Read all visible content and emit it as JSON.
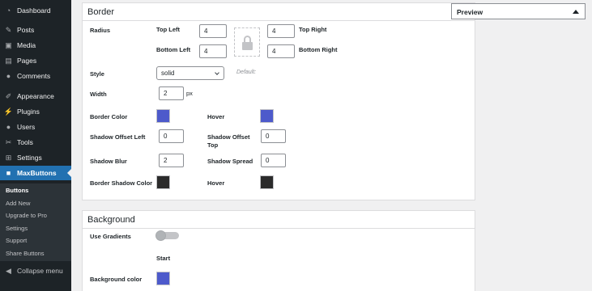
{
  "sidebar": {
    "items": [
      {
        "label": "Dashboard",
        "icon": "dashboard-icon",
        "glyph": "◔"
      },
      {
        "label": "Posts",
        "icon": "pin-icon",
        "glyph": "✎"
      },
      {
        "label": "Media",
        "icon": "media-icon",
        "glyph": "▣"
      },
      {
        "label": "Pages",
        "icon": "pages-icon",
        "glyph": "▤"
      },
      {
        "label": "Comments",
        "icon": "comments-icon",
        "glyph": "●"
      },
      {
        "label": "Appearance",
        "icon": "brush-icon",
        "glyph": "✐"
      },
      {
        "label": "Plugins",
        "icon": "plugin-icon",
        "glyph": "⚡"
      },
      {
        "label": "Users",
        "icon": "users-icon",
        "glyph": "●"
      },
      {
        "label": "Tools",
        "icon": "wrench-icon",
        "glyph": "✂"
      },
      {
        "label": "Settings",
        "icon": "settings-icon",
        "glyph": "⊞"
      },
      {
        "label": "MaxButtons",
        "icon": "maxbuttons-icon",
        "glyph": "■"
      }
    ],
    "submenu": [
      "Buttons",
      "Add New",
      "Upgrade to Pro",
      "Settings",
      "Support",
      "Share Buttons"
    ],
    "collapse_label": "Collapse menu",
    "collapse_glyph": "◀"
  },
  "border": {
    "title": "Border",
    "radius_label": "Radius",
    "top_left_label": "Top Left",
    "top_left_value": "4",
    "top_right_label": "Top Right",
    "top_right_value": "4",
    "bottom_left_label": "Bottom Left",
    "bottom_left_value": "4",
    "bottom_right_label": "Bottom Right",
    "bottom_right_value": "4",
    "style_label": "Style",
    "style_value": "solid",
    "style_default": "Default:",
    "width_label": "Width",
    "width_value": "2",
    "width_unit": "px",
    "border_color_label": "Border Color",
    "border_color": "#4d5acb",
    "hover_label": "Hover",
    "hover_color": "#4d5acb",
    "shadow_offset_left_label": "Shadow Offset Left",
    "shadow_offset_left_value": "0",
    "shadow_offset_top_label": "Shadow Offset Top",
    "shadow_offset_top_value": "0",
    "shadow_blur_label": "Shadow Blur",
    "shadow_blur_value": "2",
    "shadow_spread_label": "Shadow Spread",
    "shadow_spread_value": "0",
    "border_shadow_color_label": "Border Shadow Color",
    "border_shadow_color": "#2b2b2b",
    "shadow_hover_label": "Hover",
    "shadow_hover_color": "#2b2b2b"
  },
  "background": {
    "title": "Background",
    "use_gradients_label": "Use Gradients",
    "use_gradients_on": false,
    "start_label": "Start",
    "background_color_label": "Background color",
    "background_color": "#4d5acb"
  },
  "preview": {
    "title": "Preview"
  }
}
